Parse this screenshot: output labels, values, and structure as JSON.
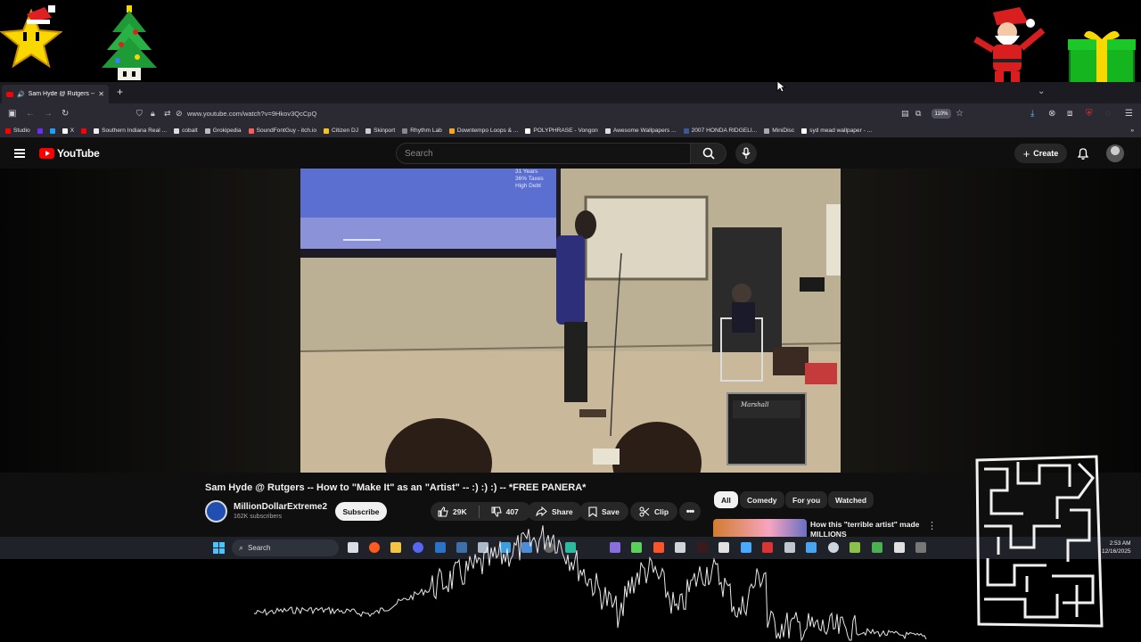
{
  "browser": {
    "tab_title": "Sam Hyde @ Rutgers -- How to \"Make It\" as an \"Artist\" -- :) :) :) -- *FREE PANERA*",
    "tab_title_visible": "Sam Hyde @ Rutgers -- Ho",
    "new_tab_label": "+",
    "url": "www.youtube.com/watch?v=9Hkov3QcCpQ",
    "zoom": "110%"
  },
  "bookmarks": [
    {
      "label": "Studio",
      "color": "#ff0000"
    },
    {
      "label": "",
      "color": "#6b2cf5"
    },
    {
      "label": "",
      "color": "#1da1f2"
    },
    {
      "label": "X",
      "color": "#ffffff"
    },
    {
      "label": "",
      "color": "#ff0000"
    },
    {
      "label": "Southern Indiana Real ...",
      "color": "#eeeeee"
    },
    {
      "label": "cobalt",
      "color": "#dddddd"
    },
    {
      "label": "Grokipedia",
      "color": "#bbbbbb"
    },
    {
      "label": "SoundFontGuy - itch.io",
      "color": "#fa5c5c"
    },
    {
      "label": "Citizen DJ",
      "color": "#f5c518"
    },
    {
      "label": "Skinport",
      "color": "#cccccc"
    },
    {
      "label": "Rhythm Lab",
      "color": "#888888"
    },
    {
      "label": "Downtempo Loops & ...",
      "color": "#f5a623"
    },
    {
      "label": "POLYPHRASE - Vongon",
      "color": "#ffffff"
    },
    {
      "label": "Awesome Wallpapers ...",
      "color": "#dddddd"
    },
    {
      "label": "2007 HONDA RIDGELI...",
      "color": "#3b5998"
    },
    {
      "label": "MiniDisc",
      "color": "#aaaaaa"
    },
    {
      "label": "syd mead wallpaper - ...",
      "color": "#ffffff"
    }
  ],
  "youtube": {
    "logo_text": "YouTube",
    "search_placeholder": "Search",
    "create_label": "Create",
    "video": {
      "slide_lines": [
        "31 Years",
        "36% Taxes",
        "High Debt"
      ],
      "amp_brand": "Marshall"
    },
    "title": "Sam Hyde @ Rutgers -- How to \"Make It\" as an \"Artist\" -- :) :) :) -- *FREE PANERA*",
    "channel_name": "MillionDollarExtreme2",
    "subscribers": "162K subscribers",
    "subscribe_label": "Subscribe",
    "likes": "29K",
    "dislikes": "407",
    "share_label": "Share",
    "save_label": "Save",
    "clip_label": "Clip",
    "chips": [
      "All",
      "Comedy",
      "For you",
      "Watched"
    ],
    "recommended": [
      {
        "title": "How this \"terrible artist\" made MILLIONS"
      }
    ]
  },
  "taskbar": {
    "search_label": "Search",
    "time": "2:53 AM",
    "date": "12/16/2025"
  },
  "colors": {
    "accent_red": "#ff0000",
    "yt_bg": "#0f0f0f",
    "browser_chrome": "#2b2a33",
    "taskbar_bg": "#1f2229",
    "windows_blue": "#4cc2ff"
  },
  "icons": [
    "star-icon",
    "christmas-tree-icon",
    "santa-icon",
    "gift-icon",
    "search-icon",
    "mic-icon",
    "bell-icon",
    "like-icon",
    "dislike-icon",
    "share-icon",
    "save-icon",
    "clip-icon",
    "more-icon",
    "windows-icon"
  ]
}
